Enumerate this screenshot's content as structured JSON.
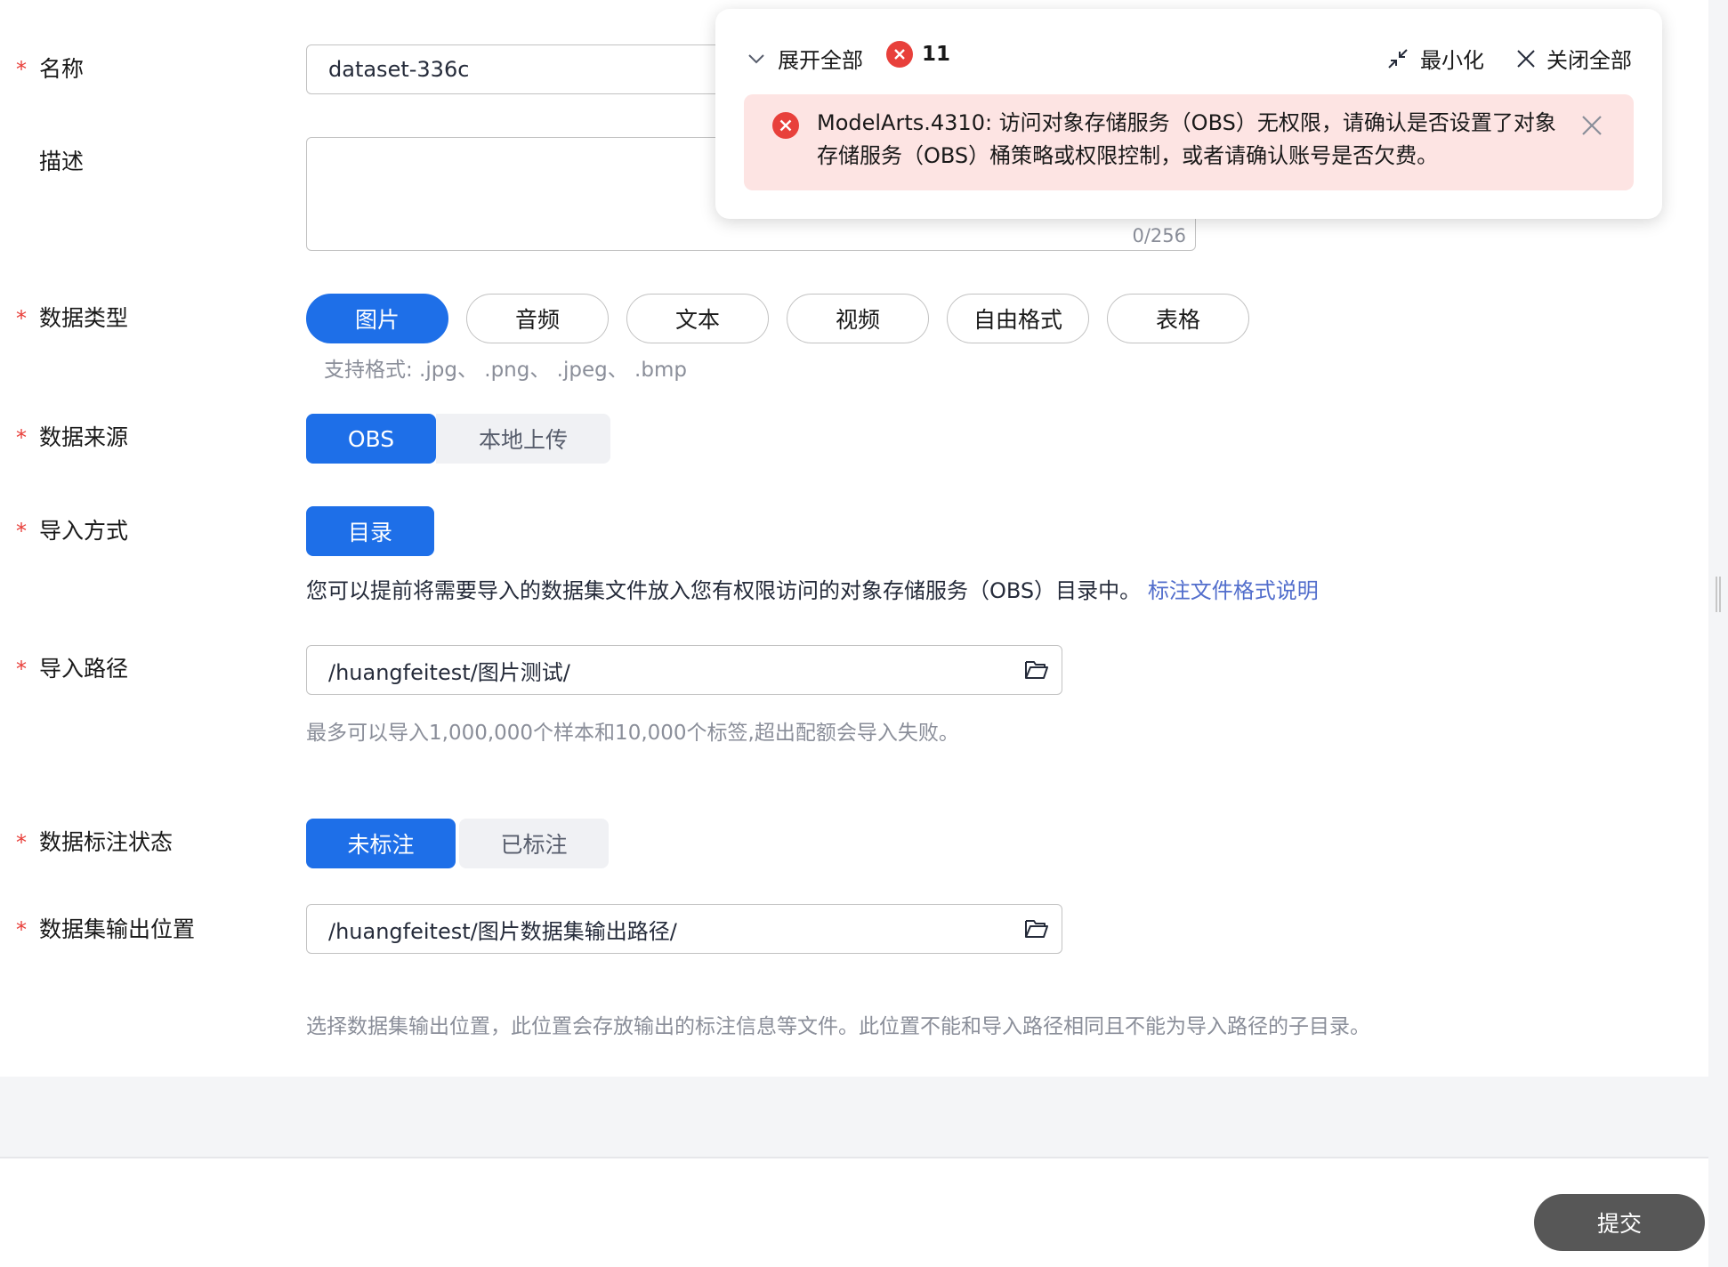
{
  "form": {
    "name": {
      "label": "名称",
      "value": "dataset-336c"
    },
    "description": {
      "label": "描述",
      "counter": "0/256"
    },
    "data_type": {
      "label": "数据类型",
      "options": [
        "图片",
        "音频",
        "文本",
        "视频",
        "自由格式",
        "表格"
      ],
      "selected": "图片",
      "formats_hint": "支持格式: .jpg、 .png、 .jpeg、 .bmp"
    },
    "data_source": {
      "label": "数据来源",
      "options": [
        "OBS",
        "本地上传"
      ],
      "selected": "OBS"
    },
    "import_method": {
      "label": "导入方式",
      "option": "目录",
      "description": "您可以提前将需要导入的数据集文件放入您有权限访问的对象存储服务（OBS）目录中。",
      "link": "标注文件格式说明"
    },
    "import_path": {
      "label": "导入路径",
      "value": "/huangfeitest/图片测试/",
      "hint": "最多可以导入1,000,000个样本和10,000个标签,超出配额会导入失败。"
    },
    "label_status": {
      "label": "数据标注状态",
      "options": [
        "未标注",
        "已标注"
      ],
      "selected": "未标注"
    },
    "output_location": {
      "label": "数据集输出位置",
      "value": "/huangfeitest/图片数据集输出路径/",
      "hint": "选择数据集输出位置，此位置会存放输出的标注信息等文件。此位置不能和导入路径相同且不能为导入路径的子目录。"
    },
    "required_mark": "*"
  },
  "footer": {
    "submit_label": "提交"
  },
  "notification": {
    "expand_all": "展开全部",
    "error_count": "11",
    "minimize": "最小化",
    "close_all": "关闭全部",
    "message_line1": "ModelArts.4310: 访问对象存储服务（OBS）无权限，请确认是否设置了对象",
    "message_line2": "存储服务（OBS）桶策略或权限控制，或者请确认账号是否欠费。"
  },
  "colors": {
    "primary": "#1e6fe8",
    "error": "#e8403b",
    "error_bg": "#fde4e3",
    "link": "#526ecc"
  }
}
